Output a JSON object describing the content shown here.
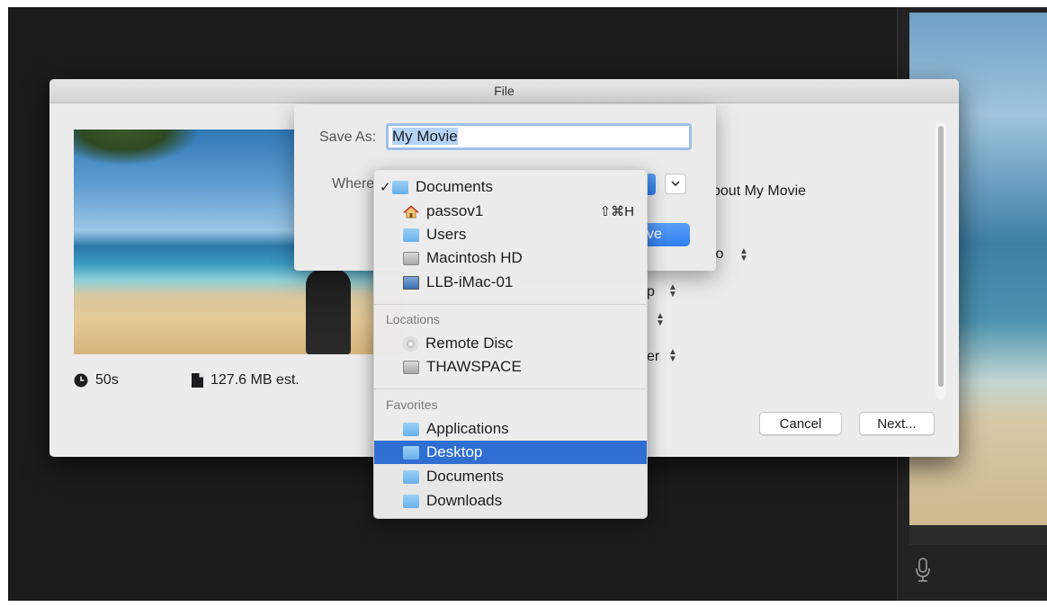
{
  "file_dialog": {
    "title": "File",
    "duration": "50s",
    "size": "127.6 MB est.",
    "partial_labels": {
      "description": "bout My Movie",
      "resolution": "io",
      "quality": "p",
      "compress": "er"
    },
    "buttons": {
      "cancel": "Cancel",
      "next": "Next..."
    }
  },
  "save_sheet": {
    "save_as_label": "Save As:",
    "save_as_value": "My Movie",
    "where_label": "Where",
    "save_button_partial": "ve"
  },
  "where_menu": {
    "items": [
      {
        "label": "Documents",
        "checked": true,
        "icon": "folder-icon"
      },
      {
        "label": "passov1",
        "shortcut": "⇧⌘H",
        "icon": "home-icon"
      },
      {
        "label": "Users",
        "icon": "folder-icon"
      },
      {
        "label": "Macintosh HD",
        "icon": "drive-icon"
      },
      {
        "label": "LLB-iMac-01",
        "icon": "computer-icon"
      }
    ],
    "locations_header": "Locations",
    "locations": [
      {
        "label": "Remote Disc",
        "icon": "disc-icon"
      },
      {
        "label": "THAWSPACE",
        "icon": "drive-icon"
      }
    ],
    "favorites_header": "Favorites",
    "favorites": [
      {
        "label": "Applications",
        "icon": "applications-folder-icon"
      },
      {
        "label": "Desktop",
        "icon": "folder-icon",
        "highlighted": true
      },
      {
        "label": "Documents",
        "icon": "folder-icon"
      },
      {
        "label": "Downloads",
        "icon": "downloads-folder-icon"
      }
    ]
  },
  "colors": {
    "accent": "#2f6fd1",
    "button_blue": "#2f7ff0",
    "selection": "#b5d3f7"
  }
}
